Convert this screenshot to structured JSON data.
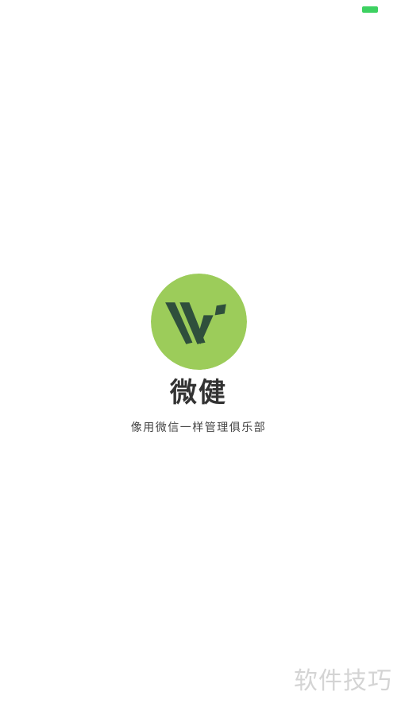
{
  "colors": {
    "background": "#ffffff",
    "battery": "#3dd161",
    "logo_circle": "#9ccc5a",
    "logo_mark": "#2f4f3c",
    "app_name": "#333333",
    "tagline": "#444444",
    "watermark": "#d4d4d4"
  },
  "status_bar": {
    "battery_icon": "battery-icon"
  },
  "splash": {
    "logo_icon": "wj-logo-icon",
    "app_name": "微健",
    "tagline": "像用微信一样管理俱乐部"
  },
  "watermark": {
    "text": "软件技巧"
  }
}
